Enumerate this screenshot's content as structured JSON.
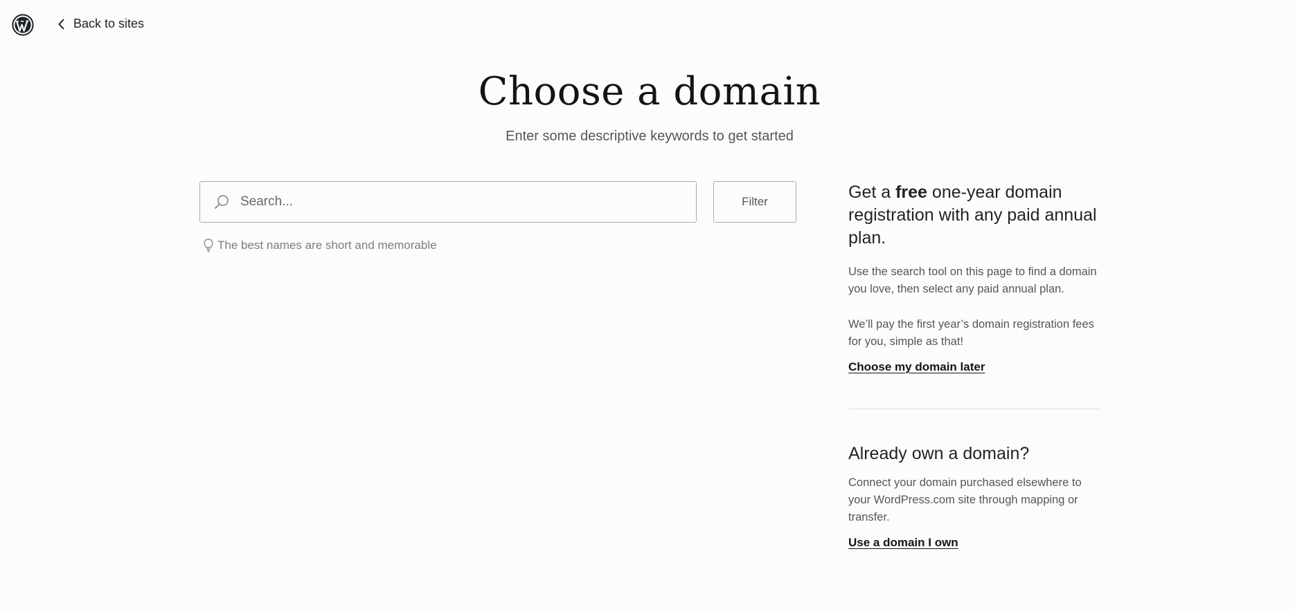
{
  "header": {
    "logo_icon": "wordpress-logo-icon",
    "back_icon": "chevron-left-icon",
    "back_label": "Back to sites"
  },
  "main": {
    "title": "Choose a domain",
    "subtitle": "Enter some descriptive keywords to get started",
    "search": {
      "icon": "search-icon",
      "placeholder": "Search...",
      "value": ""
    },
    "filter_label": "Filter",
    "hint": {
      "icon": "lightbulb-icon",
      "text": "The best names are short and memorable"
    }
  },
  "sidebar": {
    "promo": {
      "heading_prefix": "Get a ",
      "heading_bold": "free",
      "heading_suffix": " one-year domain registration with any paid annual plan.",
      "paragraph1": "Use the search tool on this page to find a domain you love, then select any paid annual plan.",
      "paragraph2": "We’ll pay the first year’s domain registration fees for you, simple as that!",
      "link": "Choose my domain later"
    },
    "own_domain": {
      "heading": "Already own a domain?",
      "paragraph": "Connect your domain purchased elsewhere to your WordPress.com site through mapping or transfer.",
      "link": "Use a domain I own"
    }
  },
  "colors": {
    "background": "#fdfcfc",
    "text": "#1d2327",
    "muted": "#50575e",
    "border": "#a7aaad"
  }
}
